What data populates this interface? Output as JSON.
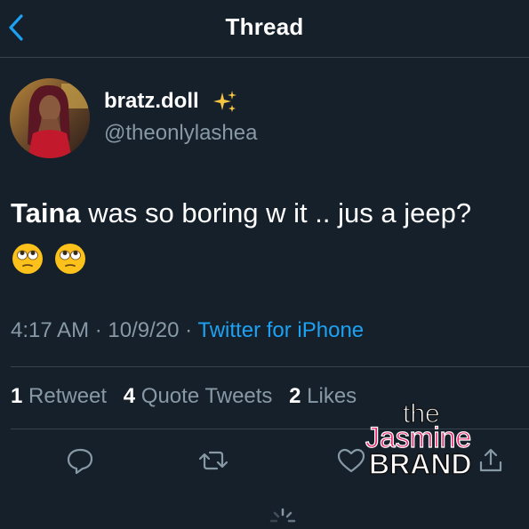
{
  "header": {
    "title": "Thread",
    "back_icon": "chevron-left-icon"
  },
  "author": {
    "display_name": "bratz.doll",
    "name_emoji": "sparkles-icon",
    "handle": "@theonlylashea"
  },
  "tweet": {
    "mention": "Taina",
    "text": " was so boring w it .. jus a jeep?",
    "emojis": [
      "face-with-rolling-eyes-icon",
      "face-with-rolling-eyes-icon"
    ]
  },
  "meta": {
    "time": "4:17 AM",
    "separator": "·",
    "date": "10/9/20",
    "source": "Twitter for iPhone"
  },
  "stats": {
    "retweets_count": "1",
    "retweets_label": "Retweet",
    "quotes_count": "4",
    "quotes_label": "Quote Tweets",
    "likes_count": "2",
    "likes_label": "Likes"
  },
  "actions": [
    "reply-icon",
    "retweet-icon",
    "like-icon",
    "share-icon"
  ],
  "watermark": {
    "line1": "the",
    "line2": "Jasmine",
    "line3": "BRAND"
  },
  "colors": {
    "background": "#15202b",
    "divider": "#38444d",
    "secondary_text": "#8899a6",
    "accent": "#1da1f2",
    "watermark_pink": "#e8246b"
  }
}
